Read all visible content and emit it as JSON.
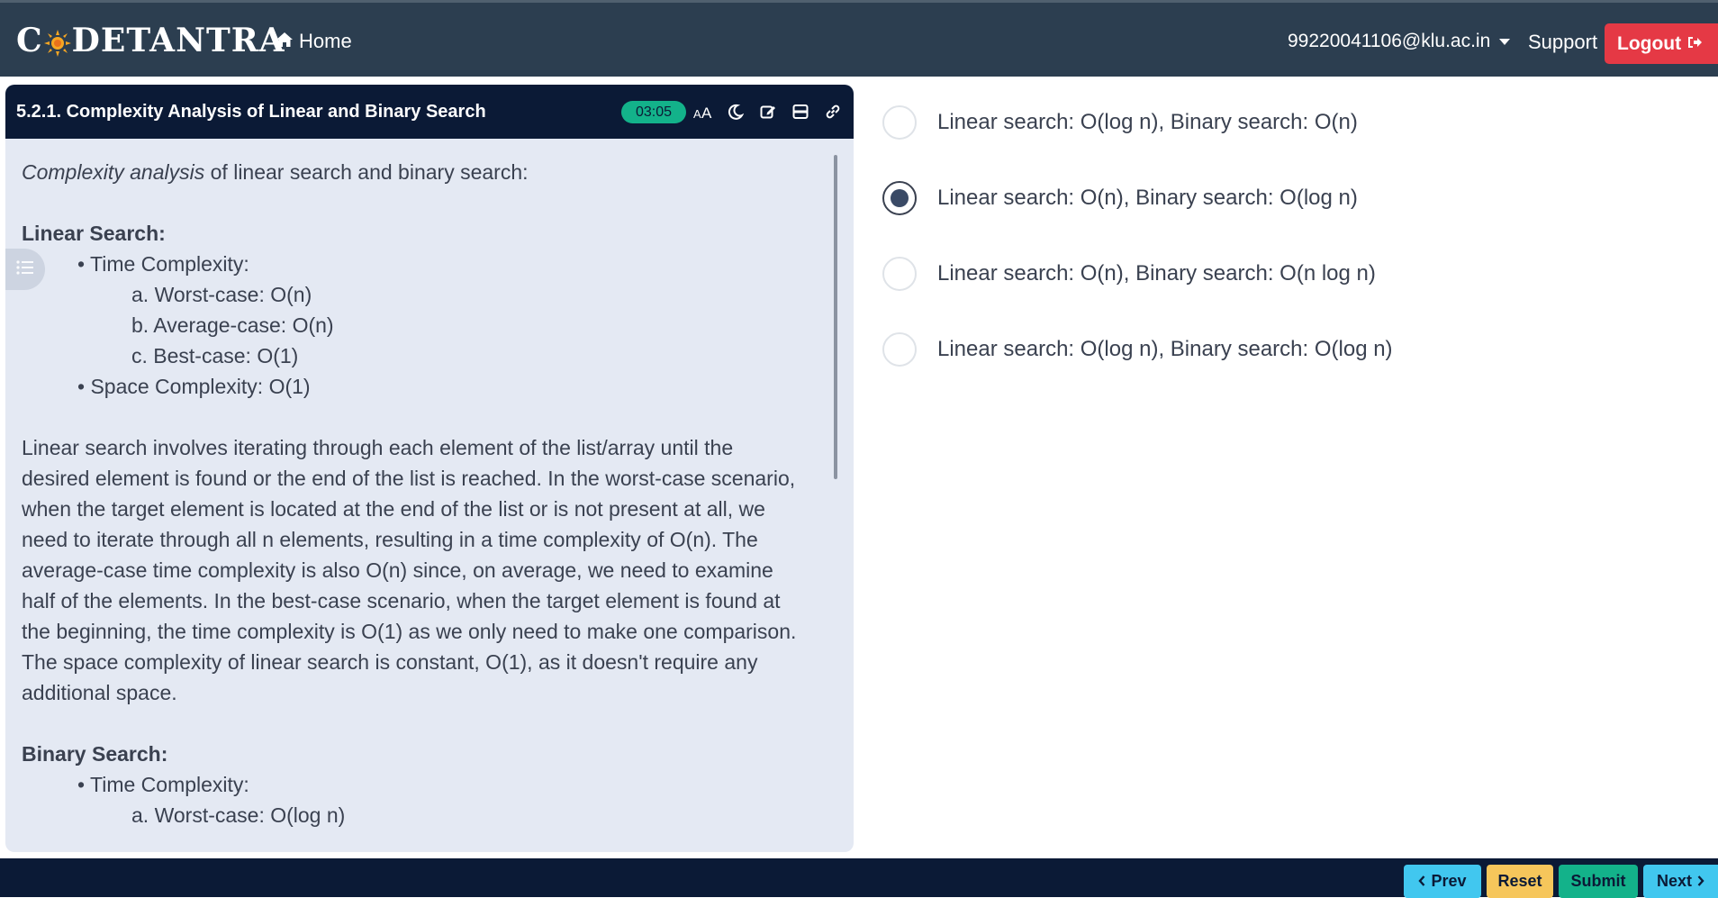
{
  "navbar": {
    "brand": "CODETANTRA",
    "home_label": "Home",
    "user_email": "99220041106@klu.ac.in",
    "support_label": "Support",
    "logout_label": "Logout"
  },
  "panel": {
    "title": "5.2.1. Complexity Analysis of Linear and Binary Search",
    "timer": "03:05",
    "tool_icons": [
      "font-size-icon",
      "dark-mode-icon",
      "edit-icon",
      "layout-icon",
      "link-icon"
    ]
  },
  "content": {
    "intro_em": "Complexity analysis",
    "intro_rest": " of linear search and binary search:",
    "linear_heading": "Linear Search:",
    "linear_time_label": "• Time Complexity:",
    "linear_worst": "a. Worst-case: O(n)",
    "linear_avg": "b. Average-case: O(n)",
    "linear_best": "c. Best-case: O(1)",
    "linear_space": "• Space Complexity: O(1)",
    "linear_para_lines": [
      "Linear search involves iterating through each element of the list/array until the",
      "desired element is found or the end of the list is reached. In the worst-case scenario,",
      "when the target element is located at the end of the list or is not present at all, we",
      "need to iterate through all n elements, resulting in a time complexity of O(n). The",
      "average-case time complexity is also O(n) since, on average, we need to examine",
      "half of the elements. In the best-case scenario, when the target element is found at",
      "the beginning, the time complexity is O(1) as we only need to make one comparison.",
      "The space complexity of linear search is constant, O(1), as it doesn't require any",
      "additional space."
    ],
    "binary_heading": "Binary Search:",
    "binary_time_label": "• Time Complexity:",
    "binary_worst": "a. Worst-case: O(log n)"
  },
  "options": [
    {
      "label": "Linear search: O(log n), Binary search: O(n)",
      "checked": false
    },
    {
      "label": "Linear search: O(n), Binary search: O(log n)",
      "checked": true
    },
    {
      "label": "Linear search: O(n), Binary search: O(n log n)",
      "checked": false
    },
    {
      "label": "Linear search: O(log n), Binary search: O(log n)",
      "checked": false
    }
  ],
  "footer": {
    "prev_label": "Prev",
    "reset_label": "Reset",
    "submit_label": "Submit",
    "next_label": "Next"
  },
  "colors": {
    "navbar_bg": "#2c3e50",
    "panel_header_bg": "#0b1a36",
    "panel_bg": "#e4e9f3",
    "logout": "#e53945",
    "timer": "#13b28a",
    "info_button": "#41c7ef",
    "warning_button": "#f6c65b"
  }
}
